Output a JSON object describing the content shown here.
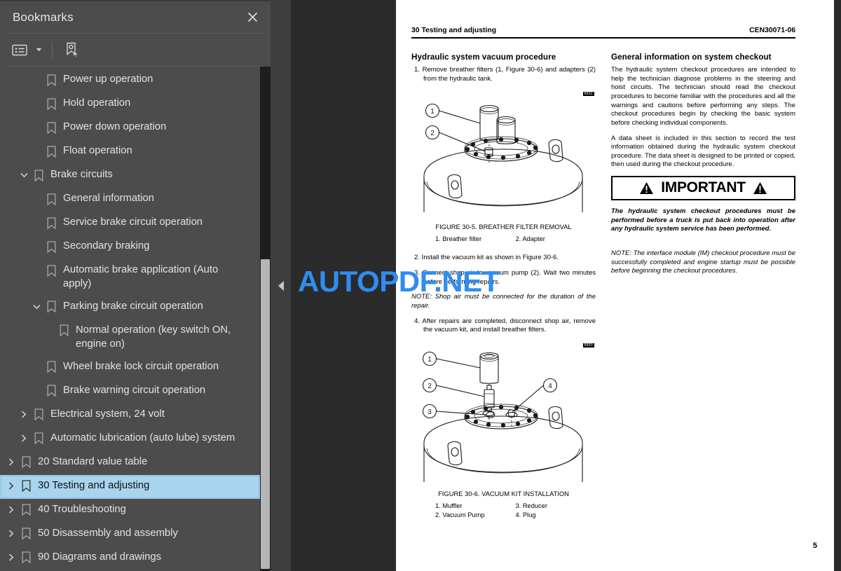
{
  "sidebar": {
    "title": "Bookmarks",
    "close_icon": "close-icon",
    "toolbar": {
      "list_options_icon": "list-options-icon",
      "caret_icon": "chevron-down-icon",
      "new_bookmark_icon": "new-bookmark-icon"
    },
    "items": [
      {
        "label": "Power up operation",
        "depth": 2,
        "twisty": "",
        "selected": false
      },
      {
        "label": "Hold operation",
        "depth": 2,
        "twisty": "",
        "selected": false
      },
      {
        "label": "Power down operation",
        "depth": 2,
        "twisty": "",
        "selected": false
      },
      {
        "label": "Float operation",
        "depth": 2,
        "twisty": "",
        "selected": false
      },
      {
        "label": "Brake circuits",
        "depth": 1,
        "twisty": "expanded",
        "selected": false
      },
      {
        "label": "General information",
        "depth": 2,
        "twisty": "",
        "selected": false
      },
      {
        "label": "Service brake circuit operation",
        "depth": 2,
        "twisty": "",
        "selected": false
      },
      {
        "label": "Secondary braking",
        "depth": 2,
        "twisty": "",
        "selected": false
      },
      {
        "label": "Automatic brake application (Auto apply)",
        "depth": 2,
        "twisty": "",
        "selected": false
      },
      {
        "label": "Parking brake circuit operation",
        "depth": 2,
        "twisty": "expanded",
        "selected": false
      },
      {
        "label": "Normal operation (key switch ON, engine on)",
        "depth": 3,
        "twisty": "",
        "selected": false
      },
      {
        "label": "Wheel brake lock circuit operation",
        "depth": 2,
        "twisty": "",
        "selected": false
      },
      {
        "label": "Brake warning circuit operation",
        "depth": 2,
        "twisty": "",
        "selected": false
      },
      {
        "label": "Electrical system, 24 volt",
        "depth": 1,
        "twisty": "collapsed",
        "selected": false
      },
      {
        "label": "Automatic lubrication (auto lube) system",
        "depth": 1,
        "twisty": "collapsed",
        "selected": false
      },
      {
        "label": "20 Standard value table",
        "depth": 0,
        "twisty": "collapsed",
        "selected": false
      },
      {
        "label": "30 Testing and adjusting",
        "depth": 0,
        "twisty": "collapsed",
        "selected": true
      },
      {
        "label": "40 Troubleshooting",
        "depth": 0,
        "twisty": "collapsed",
        "selected": false
      },
      {
        "label": "50 Disassembly and assembly",
        "depth": 0,
        "twisty": "collapsed",
        "selected": false
      },
      {
        "label": "90 Diagrams and drawings",
        "depth": 0,
        "twisty": "collapsed",
        "selected": false
      }
    ]
  },
  "collapse_strip": {
    "icon": "collapse-left-arrow-icon"
  },
  "watermark": {
    "text": "AUTOPDF.NET",
    "color": "#2e8df0"
  },
  "document": {
    "header": {
      "left": "30 Testing and adjusting",
      "right": "CEN30071-06"
    },
    "page_number": "5",
    "left_column": {
      "heading": "Hydraulic system vacuum procedure",
      "step1": "1. Remove breather filters (1, Figure 30-6) and adapters (2) from the hydraulic tank.",
      "step2": "2. Install the vacuum kit as shown in Figure 30-6.",
      "step3": "3. Connect shop air to vacuum pump (2). Wait two minutes before performing repairs.",
      "note": "NOTE: Shop air must be connected for the duration of the repair.",
      "step4": "4. After repairs are completed, disconnect shop air, remove the vacuum kit, and install breather filters.",
      "figure1": {
        "id_tag": "8892",
        "caption": "FIGURE 30-5. BREATHER FILTER REMOVAL",
        "legend_left": [
          "1. Breather filter"
        ],
        "legend_right": [
          "2. Adapter"
        ],
        "callouts": [
          "1",
          "2"
        ]
      },
      "figure2": {
        "id_tag": "8893",
        "caption": "FIGURE 30-6. VACUUM KIT INSTALLATION",
        "legend_left": [
          "1. Muffler",
          "2. Vacuum Pump"
        ],
        "legend_right": [
          "3. Reducer",
          "4. Plug"
        ],
        "callouts": [
          "1",
          "2",
          "3",
          "4"
        ]
      }
    },
    "right_column": {
      "heading": "General information on system checkout",
      "para1": "The hydraulic system checkout procedures are intended to help the technician diagnose problems in the steering and hoist circuits. The technician should read the checkout procedures to become familiar with the procedures and all the warnings and cautions before performing any steps. The checkout procedures begin by checking the basic system before checking individual components.",
      "para2": "A data sheet is included in this section to record the test information obtained during the hydraulic system checkout procedure. The data sheet is designed to be printed or copied, then used during the checkout procedure.",
      "important_label": "IMPORTANT",
      "important_text": "The hydraulic system checkout procedures must be performed before a truck is put back into operation after any hydraulic system service has been performed.",
      "note_text": "NOTE: The interface module (IM) checkout procedure must be successfully completed and engine startup must be possible before beginning the checkout procedures."
    }
  }
}
